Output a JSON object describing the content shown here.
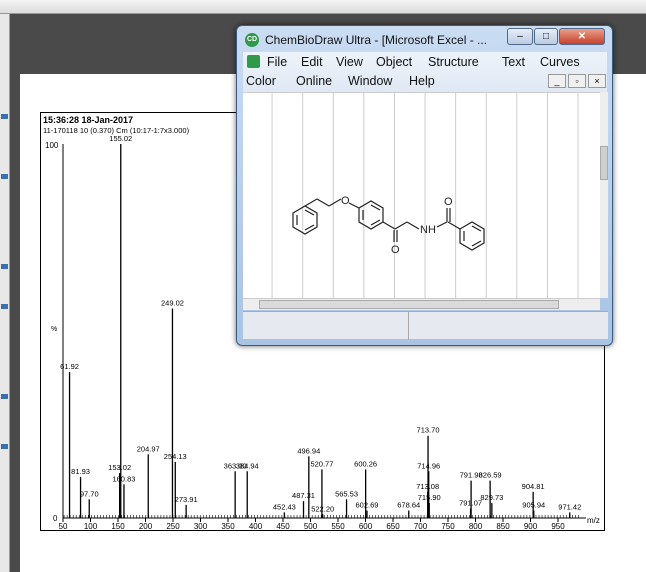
{
  "spectrum": {
    "timestamp": "15:36:28 18-Jan-2017",
    "sample_line": "11-170118 10 (0.370) Cm (10:17-1:7x3.000)",
    "y_top_label": "100",
    "y_zero_label": "0",
    "y_unit": "%",
    "x_unit": "m/z"
  },
  "chart_data": {
    "type": "bar",
    "title": "15:36:28 18-Jan-2017",
    "xlabel": "m/z",
    "ylabel": "%",
    "xlim": [
      45,
      1000
    ],
    "ylim": [
      0,
      100
    ],
    "xticks": [
      50,
      100,
      150,
      200,
      250,
      300,
      350,
      400,
      450,
      500,
      550,
      600,
      650,
      700,
      750,
      800,
      850,
      900,
      950
    ],
    "peaks": [
      {
        "mz": 61.92,
        "label": "61.92",
        "intensity": 39
      },
      {
        "mz": 81.93,
        "label": "81.93",
        "intensity": 11
      },
      {
        "mz": 97.7,
        "label": "97.70",
        "intensity": 5
      },
      {
        "mz": 153.02,
        "label": "153.02",
        "intensity": 12
      },
      {
        "mz": 155.02,
        "label": "155.02",
        "intensity": 100
      },
      {
        "mz": 160.83,
        "label": "160.83",
        "intensity": 9
      },
      {
        "mz": 204.97,
        "label": "204.97",
        "intensity": 17
      },
      {
        "mz": 249.02,
        "label": "249.02",
        "intensity": 56
      },
      {
        "mz": 254.13,
        "label": "254.13",
        "intensity": 15
      },
      {
        "mz": 273.91,
        "label": "273.91",
        "intensity": 3.5
      },
      {
        "mz": 363.0,
        "label": "363.00",
        "intensity": 12.5
      },
      {
        "mz": 384.94,
        "label": "384.94",
        "intensity": 12.5
      },
      {
        "mz": 452.43,
        "label": "452.43",
        "intensity": 1.5
      },
      {
        "mz": 487.31,
        "label": "487.31",
        "intensity": 4.5
      },
      {
        "mz": 496.94,
        "label": "496.94",
        "intensity": 16.5
      },
      {
        "mz": 520.77,
        "label": "520.77",
        "intensity": 13
      },
      {
        "mz": 522.2,
        "label": "522.20",
        "intensity": 1
      },
      {
        "mz": 565.53,
        "label": "565.53",
        "intensity": 5
      },
      {
        "mz": 600.26,
        "label": "600.26",
        "intensity": 13
      },
      {
        "mz": 602.69,
        "label": "602.69",
        "intensity": 2
      },
      {
        "mz": 678.64,
        "label": "678.64",
        "intensity": 2
      },
      {
        "mz": 713.08,
        "label": "713.08",
        "intensity": 7
      },
      {
        "mz": 713.7,
        "label": "713.70",
        "intensity": 22
      },
      {
        "mz": 714.96,
        "label": "714.96",
        "intensity": 12.5
      },
      {
        "mz": 715.9,
        "label": "715.90",
        "intensity": 4
      },
      {
        "mz": 791.07,
        "label": "791.07",
        "intensity": 2.5
      },
      {
        "mz": 791.98,
        "label": "791.98",
        "intensity": 10
      },
      {
        "mz": 826.59,
        "label": "826.59",
        "intensity": 10
      },
      {
        "mz": 829.73,
        "label": "829.73",
        "intensity": 4
      },
      {
        "mz": 904.81,
        "label": "904.81",
        "intensity": 7
      },
      {
        "mz": 905.94,
        "label": "905.94",
        "intensity": 2
      },
      {
        "mz": 971.42,
        "label": "971.42",
        "intensity": 1.5
      }
    ]
  },
  "chembiodraw": {
    "title": "ChemBioDraw Ultra - [Microsoft Excel - ...",
    "app_icon": "CD",
    "menu": [
      "File",
      "Edit",
      "View",
      "Object",
      "Structure",
      "Text",
      "Curves",
      "Color",
      "Online",
      "Window",
      "Help"
    ],
    "accent": "#2e9a4a"
  }
}
